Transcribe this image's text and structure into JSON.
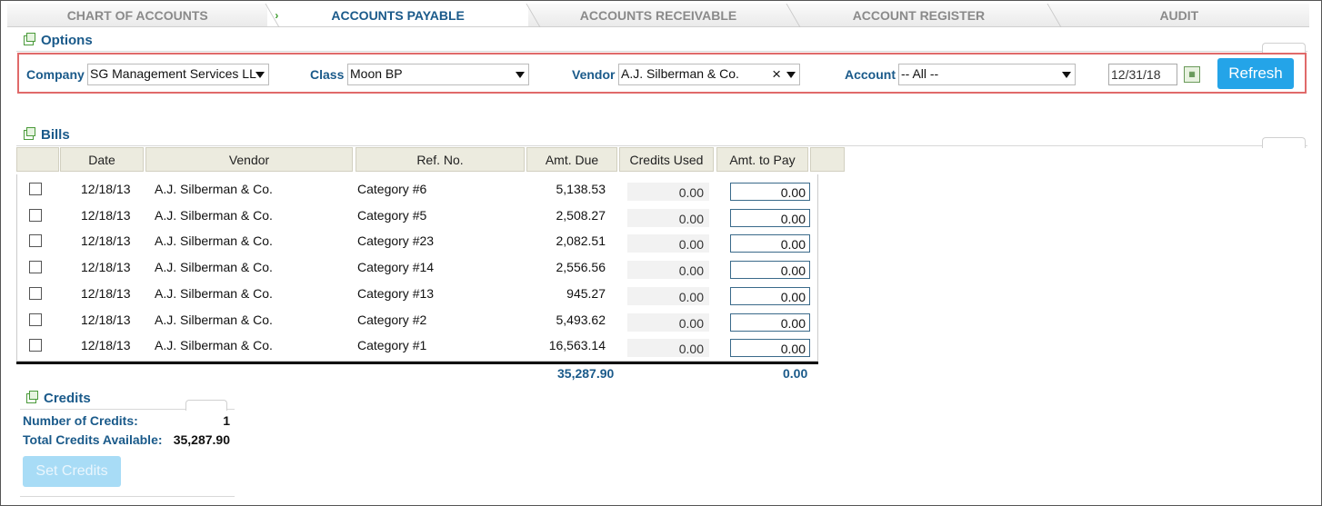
{
  "tabs": [
    {
      "label": "CHART OF ACCOUNTS",
      "active": false
    },
    {
      "label": "ACCOUNTS PAYABLE",
      "active": true
    },
    {
      "label": "ACCOUNTS RECEIVABLE",
      "active": false
    },
    {
      "label": "ACCOUNT REGISTER",
      "active": false
    },
    {
      "label": "AUDIT",
      "active": false
    }
  ],
  "options": {
    "title": "Options",
    "company_label": "Company",
    "company_value": "SG Management Services LL",
    "class_label": "Class",
    "class_value": "Moon BP",
    "vendor_label": "Vendor",
    "vendor_value": "A.J. Silberman & Co.",
    "account_label": "Account",
    "account_value": "-- All --",
    "date_value": "12/31/18",
    "refresh_label": "Refresh"
  },
  "bills": {
    "title": "Bills",
    "columns": [
      "Date",
      "Vendor",
      "Ref. No.",
      "Amt. Due",
      "Credits Used",
      "Amt. to Pay"
    ],
    "rows": [
      {
        "date": "12/18/13",
        "vendor": "A.J. Silberman & Co.",
        "ref": "Category #6",
        "amt_due": "5,138.53",
        "credits_used": "0.00",
        "amt_to_pay": "0.00"
      },
      {
        "date": "12/18/13",
        "vendor": "A.J. Silberman & Co.",
        "ref": "Category #5",
        "amt_due": "2,508.27",
        "credits_used": "0.00",
        "amt_to_pay": "0.00"
      },
      {
        "date": "12/18/13",
        "vendor": "A.J. Silberman & Co.",
        "ref": "Category #23",
        "amt_due": "2,082.51",
        "credits_used": "0.00",
        "amt_to_pay": "0.00"
      },
      {
        "date": "12/18/13",
        "vendor": "A.J. Silberman & Co.",
        "ref": "Category #14",
        "amt_due": "2,556.56",
        "credits_used": "0.00",
        "amt_to_pay": "0.00"
      },
      {
        "date": "12/18/13",
        "vendor": "A.J. Silberman & Co.",
        "ref": "Category #13",
        "amt_due": "945.27",
        "credits_used": "0.00",
        "amt_to_pay": "0.00"
      },
      {
        "date": "12/18/13",
        "vendor": "A.J. Silberman & Co.",
        "ref": "Category #2",
        "amt_due": "5,493.62",
        "credits_used": "0.00",
        "amt_to_pay": "0.00"
      },
      {
        "date": "12/18/13",
        "vendor": "A.J. Silberman & Co.",
        "ref": "Category #1",
        "amt_due": "16,563.14",
        "credits_used": "0.00",
        "amt_to_pay": "0.00"
      }
    ],
    "total_amt_due": "35,287.90",
    "total_amt_to_pay": "0.00"
  },
  "credits": {
    "title": "Credits",
    "number_label": "Number of Credits:",
    "number_value": "1",
    "total_label": "Total Credits Available:",
    "total_value": "35,287.90",
    "set_credits_label": "Set Credits"
  },
  "colors": {
    "accent": "#1a5a8a",
    "button": "#24a4e8",
    "highlight_border": "#e06a6a"
  }
}
